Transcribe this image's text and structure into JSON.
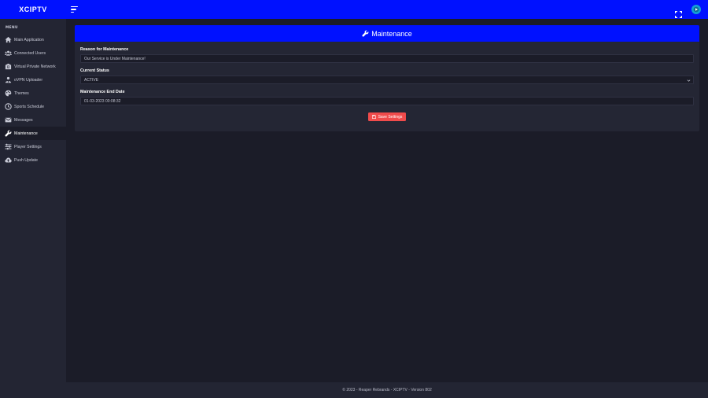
{
  "app": {
    "brand": "XCIPTV"
  },
  "colors": {
    "primary": "#0011ff",
    "danger": "#f04b4b",
    "background": "#1b1c28",
    "sidebar": "#232533"
  },
  "header": {
    "menu_icon": "hamburger-icon",
    "fullscreen_icon": "fullscreen-icon",
    "avatar_icon": "avatar-icon"
  },
  "sidebar": {
    "title": "MENU",
    "items": [
      {
        "label": "Main Application",
        "icon": "home-icon",
        "active": false
      },
      {
        "label": "Connected Users",
        "icon": "users-icon",
        "active": false
      },
      {
        "label": "Virtual Private Network",
        "icon": "vpn-icon",
        "active": false
      },
      {
        "label": "oVPN Uploader",
        "icon": "user-upload-icon",
        "active": false
      },
      {
        "label": "Themes",
        "icon": "palette-icon",
        "active": false
      },
      {
        "label": "Sports Schedule",
        "icon": "clock-icon",
        "active": false
      },
      {
        "label": "Messages",
        "icon": "envelope-icon",
        "active": false
      },
      {
        "label": "Maintenance",
        "icon": "wrench-icon",
        "active": true
      },
      {
        "label": "Player Settings",
        "icon": "sliders-icon",
        "active": false
      },
      {
        "label": "Push Update",
        "icon": "cloud-upload-icon",
        "active": false
      }
    ]
  },
  "main": {
    "title": "Maintenance",
    "title_icon": "wrench-icon",
    "fields": {
      "reason": {
        "label": "Reason for Maintenance",
        "value": "Our Service is Under Maintenance!"
      },
      "status": {
        "label": "Current Status",
        "value": "ACTIVE"
      },
      "end_date": {
        "label": "Maintenance End Date",
        "value": "01-03-2023 00:08:32"
      }
    },
    "save_button": {
      "label": "Save Settings",
      "icon": "save-icon"
    }
  },
  "footer": {
    "text": "© 2023 - Reaper Rebrands - XCIPTV - Version 802"
  }
}
